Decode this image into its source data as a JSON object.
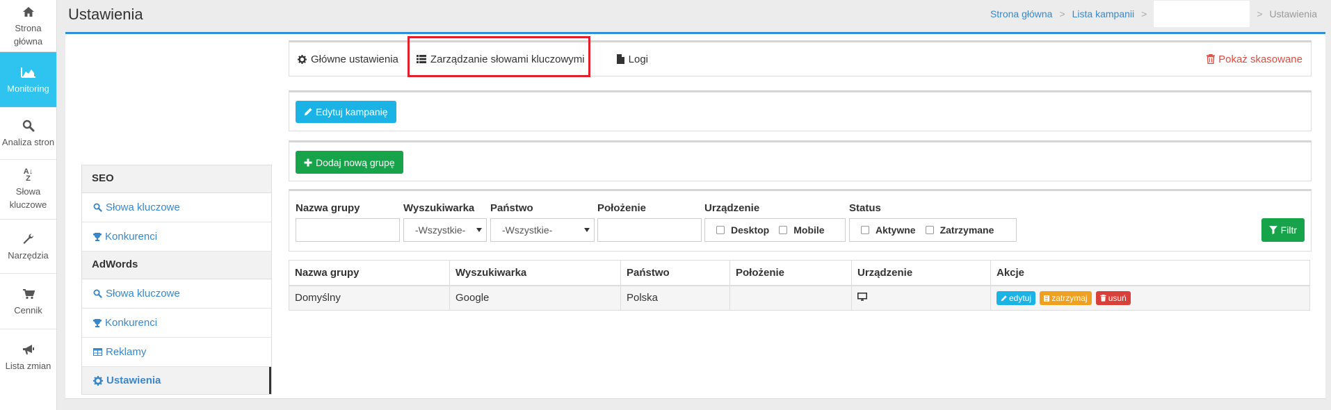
{
  "leftnav": {
    "items": [
      {
        "icon": "home-icon",
        "label": "Strona główna"
      },
      {
        "icon": "chart-area-icon",
        "label": "Monitoring"
      },
      {
        "icon": "search-icon",
        "label": "Analiza stron"
      },
      {
        "icon": "sort-alpha-icon",
        "label": "Słowa kluczowe"
      },
      {
        "icon": "wrench-icon",
        "label": "Narzędzia"
      },
      {
        "icon": "cart-icon",
        "label": "Cennik"
      },
      {
        "icon": "bullhorn-icon",
        "label": "Lista zmian"
      }
    ],
    "active_index": 1,
    "active_color": "#2ec4ef"
  },
  "header": {
    "title": "Ustawienia",
    "breadcrumb": [
      "Strona główna",
      "Lista kampanii",
      "",
      "Ustawienia"
    ],
    "separator": ">"
  },
  "sidemenu": {
    "seo_heading": "SEO",
    "seo_items": [
      "Słowa kluczowe",
      "Konkurenci"
    ],
    "adwords_heading": "AdWords",
    "adwords_items": [
      "Słowa kluczowe",
      "Konkurenci",
      "Reklamy",
      "Ustawienia"
    ]
  },
  "tabs": {
    "main": "Główne ustawienia",
    "keywords": "Zarządzanie słowami kluczowymi",
    "logs": "Logi",
    "deleted": "Pokaż skasowane",
    "highlight_color": "#e0202a"
  },
  "buttons": {
    "edit_campaign": "Edytuj kampanię",
    "add_group": "Dodaj nową grupę",
    "filter": "Filtr"
  },
  "filters": {
    "group_name_label": "Nazwa grupy",
    "engine_label": "Wyszukiwarka",
    "engine_value": "-Wszystkie-",
    "country_label": "Państwo",
    "country_value": "-Wszystkie-",
    "location_label": "Położenie",
    "device_label": "Urządzenie",
    "device_options": [
      "Desktop",
      "Mobile"
    ],
    "status_label": "Status",
    "status_options": [
      "Aktywne",
      "Zatrzymane"
    ]
  },
  "table": {
    "columns": [
      "Nazwa grupy",
      "Wyszukiwarka",
      "Państwo",
      "Położenie",
      "Urządzenie",
      "Akcje"
    ],
    "rows": [
      {
        "name": "Domyślny",
        "engine": "Google",
        "country": "Polska",
        "location": "",
        "device_icon": "desktop-icon"
      }
    ],
    "actions": {
      "edit": "edytuj",
      "stop": "zatrzymaj",
      "delete": "usuń"
    }
  },
  "colors": {
    "primary": "#2e8fd8",
    "info": "#1bb3e6",
    "success": "#16a34a",
    "warning": "#f0a020",
    "danger": "#d9403a",
    "link": "#3a87c8"
  }
}
